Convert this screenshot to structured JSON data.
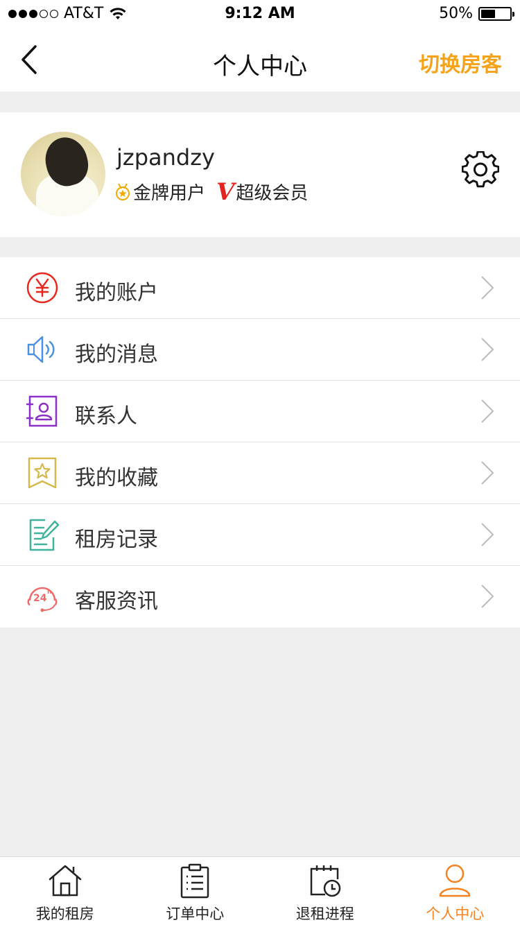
{
  "status_bar": {
    "carrier": "AT&T",
    "time": "9:12 AM",
    "battery_percent": "50%",
    "battery_level": 0.5,
    "signal_bars_filled": 3,
    "signal_bars_total": 5
  },
  "nav": {
    "title": "个人中心",
    "action_label": "切换房客",
    "back_icon": "chevron-left-icon"
  },
  "profile": {
    "username": "jzpandzy",
    "badge_gold": "金牌用户",
    "badge_vip_mark": "V",
    "badge_vip": "超级会员",
    "settings_icon": "gear-icon"
  },
  "menu": {
    "items": [
      {
        "label": "我的账户",
        "icon": "yen-icon",
        "color": "#e8281e"
      },
      {
        "label": "我的消息",
        "icon": "speaker-icon",
        "color": "#4a90e2"
      },
      {
        "label": "联系人",
        "icon": "contacts-icon",
        "color": "#8b2fc9"
      },
      {
        "label": "我的收藏",
        "icon": "star-bookmark-icon",
        "color": "#d4b84a"
      },
      {
        "label": "租房记录",
        "icon": "document-edit-icon",
        "color": "#3fb39b"
      },
      {
        "label": "客服资讯",
        "icon": "headset-24h-icon",
        "color": "#f06a6a"
      }
    ]
  },
  "tab_bar": {
    "tabs": [
      {
        "label": "我的租房",
        "icon": "house-icon",
        "active": false
      },
      {
        "label": "订单中心",
        "icon": "clipboard-list-icon",
        "active": false
      },
      {
        "label": "退租进程",
        "icon": "calendar-clock-icon",
        "active": false
      },
      {
        "label": "个人中心",
        "icon": "person-icon",
        "active": true
      }
    ],
    "active_color": "#f58220"
  },
  "colors": {
    "accent": "#f7a21b",
    "background": "#efefef"
  }
}
